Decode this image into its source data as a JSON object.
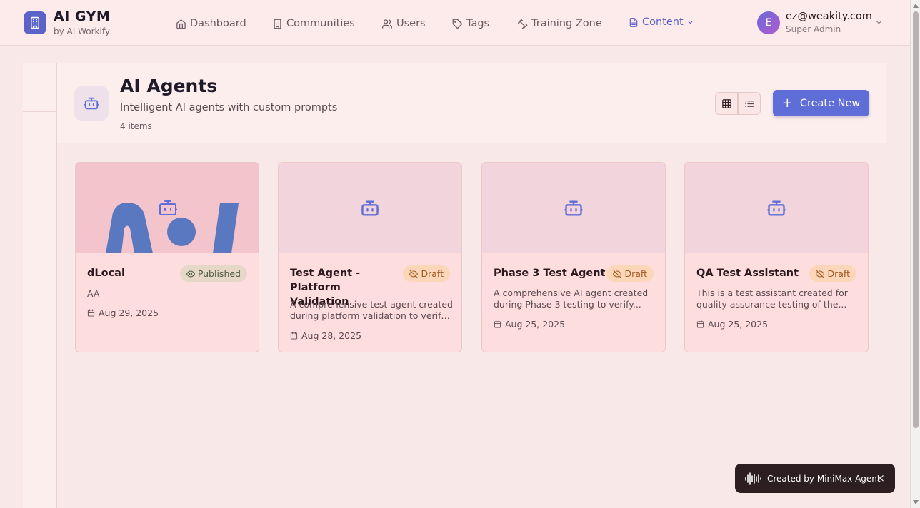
{
  "brand": {
    "title": "AI GYM",
    "subtitle": "by AI Workify"
  },
  "nav": {
    "dashboard": "Dashboard",
    "communities": "Communities",
    "users": "Users",
    "tags": "Tags",
    "training": "Training Zone",
    "content": "Content"
  },
  "user": {
    "initial": "E",
    "email": "ez@weakity.com",
    "role": "Super Admin"
  },
  "section": {
    "title": "AI Agents",
    "description": "Intelligent AI agents with custom prompts",
    "count": "4 items",
    "create_label": "Create New"
  },
  "cards": [
    {
      "title": "dLocal",
      "status": "Published",
      "desc": "AA",
      "date": "Aug 29, 2025"
    },
    {
      "title": "Test Agent - Platform Validation",
      "status": "Draft",
      "desc_line1": "A comprehensive test agent created",
      "desc_line2": "during platform validation to verify...",
      "date": "Aug 28, 2025"
    },
    {
      "title": "Phase 3 Test Agent",
      "status": "Draft",
      "desc_line1": "A comprehensive AI agent created",
      "desc_line2": "during Phase 3 testing to verify...",
      "date": "Aug 25, 2025"
    },
    {
      "title": "QA Test Assistant",
      "status": "Draft",
      "desc_line1": "This is a test assistant created for",
      "desc_line2": "quality assurance testing of the...",
      "date": "Aug 25, 2025"
    }
  ],
  "toast": {
    "label": "Created by MiniMax Agent",
    "close": "×"
  },
  "colors": {
    "accent": "#5f6dd6",
    "published_bg": "#e6d8c9",
    "draft_bg": "#fbd6b8",
    "page_bg": "#f9e8e8"
  },
  "icons": {
    "brand": "building-icon",
    "dashboard": "home-icon",
    "communities": "building-icon",
    "users": "users-icon",
    "tags": "tag-icon",
    "training": "dumbbell-icon",
    "content": "file-text-icon",
    "agent": "bot-icon",
    "published": "eye-icon",
    "draft": "eye-off-icon",
    "date": "calendar-icon",
    "grid": "grid-icon",
    "list": "list-icon"
  }
}
